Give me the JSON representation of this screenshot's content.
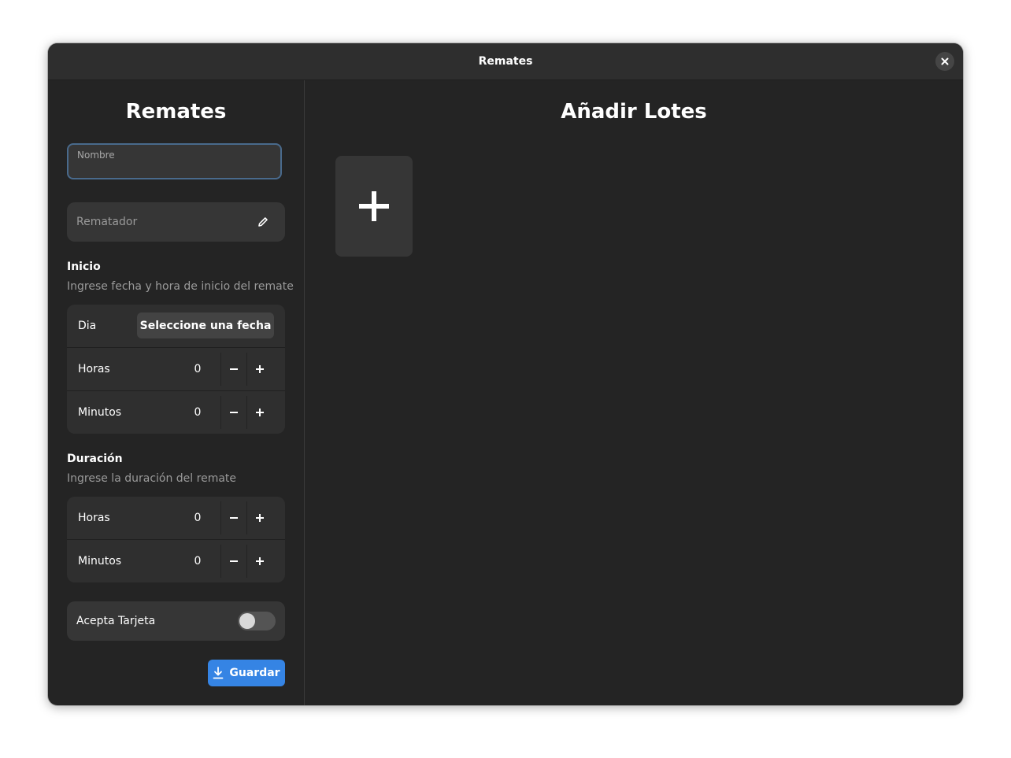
{
  "window": {
    "title": "Remates"
  },
  "sidebar": {
    "heading": "Remates",
    "nombre": {
      "label": "Nombre",
      "value": ""
    },
    "rematador": {
      "placeholder": "Rematador"
    },
    "inicio": {
      "title": "Inicio",
      "subtitle": "Ingrese fecha y hora de inicio del remate",
      "dia_label": "Dia",
      "date_button": "Seleccione una fecha",
      "horas_label": "Horas",
      "horas_value": "0",
      "minutos_label": "Minutos",
      "minutos_value": "0"
    },
    "duracion": {
      "title": "Duración",
      "subtitle": "Ingrese la duración del remate",
      "horas_label": "Horas",
      "horas_value": "0",
      "minutos_label": "Minutos",
      "minutos_value": "0"
    },
    "tarjeta": {
      "label": "Acepta Tarjeta",
      "enabled": false
    },
    "save_label": "Guardar"
  },
  "main": {
    "heading": "Añadir Lotes"
  },
  "icons": {
    "close": "close-icon",
    "edit": "pencil-icon",
    "minus": "minus-icon",
    "plus": "plus-icon",
    "download": "download-icon",
    "add": "add-icon"
  },
  "colors": {
    "accent": "#3584e4",
    "window_bg": "#242424",
    "header_bg": "#2e2e2e",
    "focus_border": "#496a8c"
  }
}
